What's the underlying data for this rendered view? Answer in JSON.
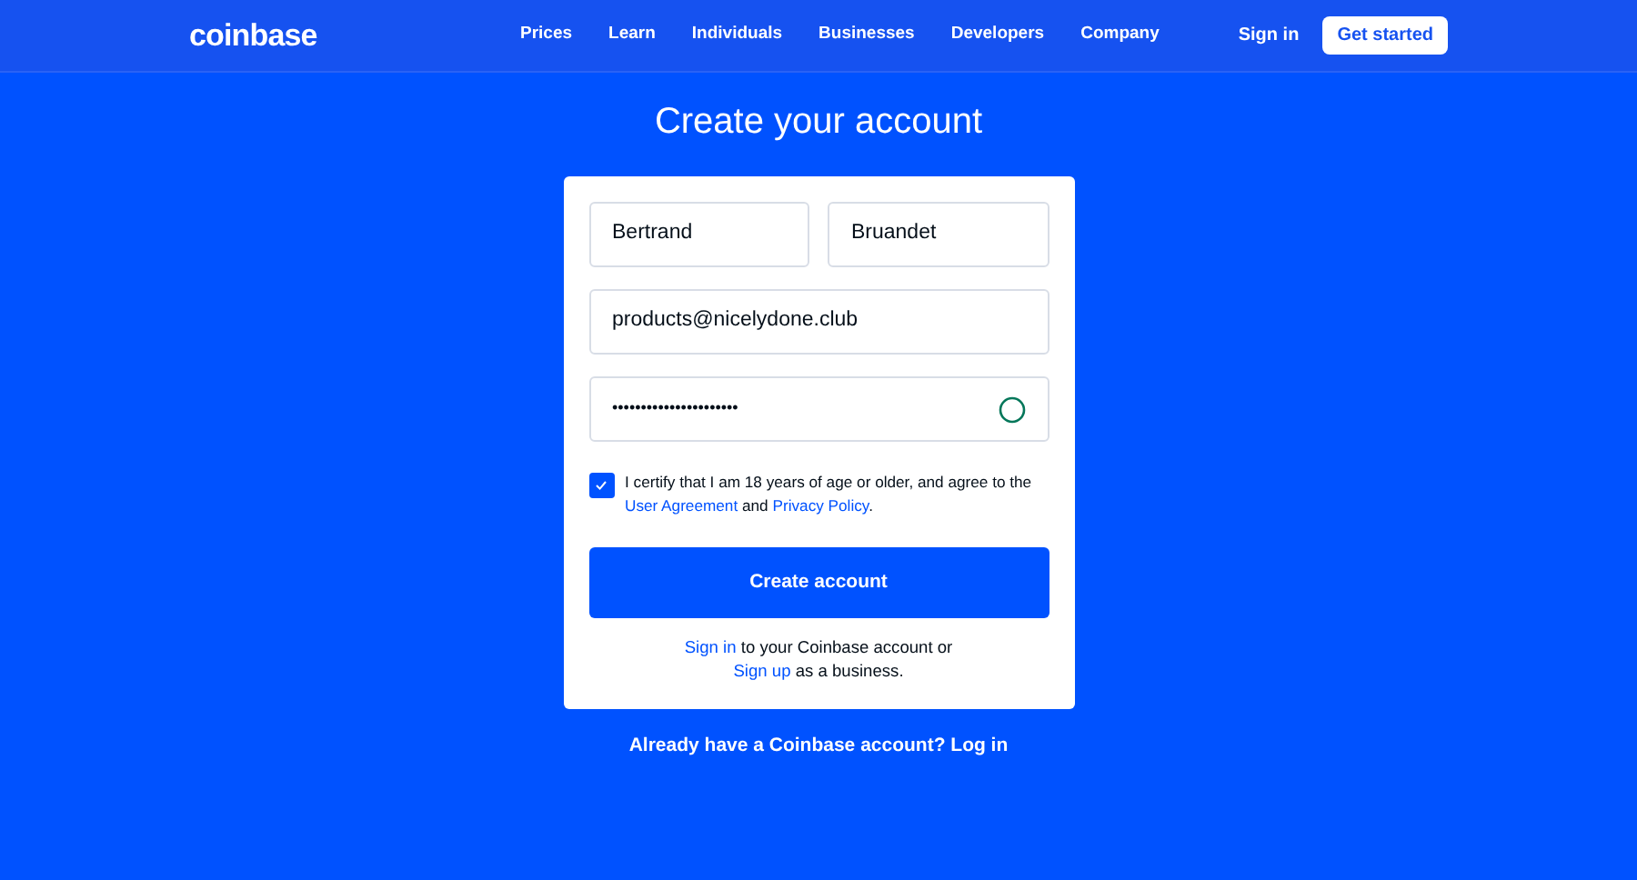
{
  "nav": {
    "logo": "coinbase",
    "links": [
      "Prices",
      "Learn",
      "Individuals",
      "Businesses",
      "Developers",
      "Company"
    ],
    "sign_in": "Sign in",
    "get_started": "Get started"
  },
  "heading": "Create your account",
  "form": {
    "first_name": "Bertrand",
    "last_name": "Bruandet",
    "email": "products@nicelydone.club",
    "password": "••••••••••••••••••••••",
    "agree": {
      "checked": true,
      "parts": [
        {
          "kind": "text",
          "text": "I certify that I am 18 years of age or older, and agree to the "
        },
        {
          "kind": "link",
          "text": "User Agreement"
        },
        {
          "kind": "text",
          "text": " and "
        },
        {
          "kind": "link",
          "text": "Privacy Policy"
        },
        {
          "kind": "text",
          "text": "."
        }
      ]
    },
    "submit": "Create account",
    "footer_lines": [
      [
        {
          "kind": "link",
          "text": "Sign in"
        },
        {
          "kind": "text",
          "text": " to your Coinbase account or"
        }
      ],
      [
        {
          "kind": "link",
          "text": "Sign up"
        },
        {
          "kind": "text",
          "text": " as a business."
        }
      ]
    ]
  },
  "login_prompt": "Already have a Coinbase account? Log in"
}
